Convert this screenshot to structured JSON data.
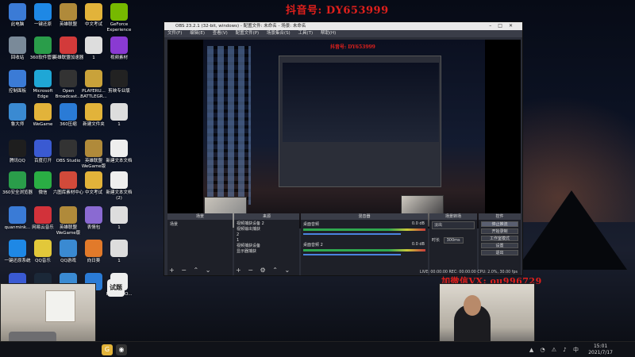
{
  "watermarks": {
    "top": "抖音号: DY653999",
    "inner": "抖音号: DY653999",
    "wechat": "加微信VX: ou996729"
  },
  "desktop_icons": [
    {
      "label": "此电脑",
      "icon": "computer-icon",
      "color": "#3b7bd6"
    },
    {
      "label": "一键还原",
      "icon": "restore-icon",
      "color": "#1e88e5"
    },
    {
      "label": "英雄联盟",
      "icon": "lol-icon",
      "color": "#b08a3a"
    },
    {
      "label": "中文考试",
      "icon": "folder-icon",
      "color": "#e2b33a"
    },
    {
      "label": "GeForce Experience",
      "icon": "nvidia-icon",
      "color": "#76b900"
    },
    {
      "label": "回收站",
      "icon": "recycle-bin-icon",
      "color": "#7a8a99"
    },
    {
      "label": "360软件管家",
      "icon": "360-manager-icon",
      "color": "#2a9d4a"
    },
    {
      "label": "英雄联盟加速器",
      "icon": "accelerator-icon",
      "color": "#d23a3a"
    },
    {
      "label": "1",
      "icon": "file-icon",
      "color": "#dddddd"
    },
    {
      "label": "视频素材",
      "icon": "video-folder-icon",
      "color": "#8a3ad2"
    },
    {
      "label": "控制面板",
      "icon": "control-panel-icon",
      "color": "#3b7bd6"
    },
    {
      "label": "Microsoft Edge",
      "icon": "edge-icon",
      "color": "#1fa7d6"
    },
    {
      "label": "Open Broadcast...",
      "icon": "obs-icon",
      "color": "#333333"
    },
    {
      "label": "PLAYERU... BATTLEGR...",
      "icon": "pubg-icon",
      "color": "#c9a23a"
    },
    {
      "label": "剪映专业版",
      "icon": "capcut-icon",
      "color": "#222222"
    },
    {
      "label": "鲁大师",
      "icon": "ludashi-icon",
      "color": "#3a8ad2"
    },
    {
      "label": "WeGame",
      "icon": "wegame-icon",
      "color": "#e2b33a"
    },
    {
      "label": "360压缩",
      "icon": "zip-icon",
      "color": "#2a7bd6"
    },
    {
      "label": "新建文件夹",
      "icon": "folder-icon",
      "color": "#e2b33a"
    },
    {
      "label": "1",
      "icon": "file-icon",
      "color": "#dddddd"
    },
    {
      "label": "腾讯QQ",
      "icon": "qq-icon",
      "color": "#1e1e1e"
    },
    {
      "label": "百度打开",
      "icon": "baidu-icon",
      "color": "#3a5ad2"
    },
    {
      "label": "OBS Studio",
      "icon": "obs-icon",
      "color": "#333333"
    },
    {
      "label": "英雄联盟 WeGame版",
      "icon": "lol-icon",
      "color": "#b08a3a"
    },
    {
      "label": "新建文本文档",
      "icon": "text-file-icon",
      "color": "#eeeeee"
    },
    {
      "label": "360安全浏览器",
      "icon": "360-browser-icon",
      "color": "#2a9d4a"
    },
    {
      "label": "微信",
      "icon": "wechat-icon",
      "color": "#2aae44"
    },
    {
      "label": "六图库素材中心",
      "icon": "gallery-icon",
      "color": "#d24a3a"
    },
    {
      "label": "中文考试",
      "icon": "folder-icon",
      "color": "#e2b33a"
    },
    {
      "label": "新建文本文档 (2)",
      "icon": "text-file-icon",
      "color": "#eeeeee"
    },
    {
      "label": "quanmink...",
      "icon": "app-icon",
      "color": "#3a7bd6"
    },
    {
      "label": "网易云音乐",
      "icon": "netease-music-icon",
      "color": "#d2323a"
    },
    {
      "label": "英雄联盟 WeGame版",
      "icon": "lol-icon",
      "color": "#b08a3a"
    },
    {
      "label": "表情包",
      "icon": "emoji-folder-icon",
      "color": "#8a6ad2"
    },
    {
      "label": "1",
      "icon": "file-icon",
      "color": "#dddddd"
    },
    {
      "label": "一键还原系统",
      "icon": "restore-icon",
      "color": "#1e88e5"
    },
    {
      "label": "QQ音乐",
      "icon": "qq-music-icon",
      "color": "#e2c83a"
    },
    {
      "label": "QQ游戏",
      "icon": "qq-game-icon",
      "color": "#3a8ad2"
    },
    {
      "label": "向日葵",
      "icon": "sunflower-icon",
      "color": "#e27a2a"
    },
    {
      "label": "1",
      "icon": "file-icon",
      "color": "#dddddd"
    },
    {
      "label": "",
      "icon": "app-icon",
      "color": "#3a5ad2"
    },
    {
      "label": "",
      "icon": "steam-icon",
      "color": "#1b2838"
    },
    {
      "label": "",
      "icon": "app-icon",
      "color": "#3a8ad2"
    },
    {
      "label": "",
      "icon": "app-icon",
      "color": "#2a7bd6"
    },
    {
      "label": "ISBTFLIEO...",
      "icon": "text-file-icon",
      "color": "#eeeeee"
    }
  ],
  "desktop_note": "试题",
  "obs": {
    "title": "OBS 23.2.1 (32-bit, windows) - 配置文件: 未命名 - 场景: 未命名",
    "menu": [
      "文件(F)",
      "编辑(E)",
      "查看(V)",
      "配置文件(P)",
      "场景集合(S)",
      "工具(T)",
      "帮助(H)"
    ],
    "docks": {
      "scenes": {
        "title": "场景",
        "items": [
          "场景"
        ]
      },
      "sources": {
        "title": "来源",
        "items": [
          "视频捕获设备 2",
          "视频输出捕获",
          "2",
          "1",
          "视频捕获设备",
          "显示器捕获"
        ]
      },
      "mixer": {
        "title": "混音器",
        "channels": [
          {
            "name": "桌面音频",
            "db": "0.0 dB"
          },
          {
            "name": "桌面音频 2",
            "db": "0.0 dB"
          }
        ]
      },
      "transitions": {
        "title": "场景转场",
        "type": "淡出",
        "duration_label": "时长",
        "duration": "300ms"
      },
      "controls": {
        "title": "控件",
        "buttons": [
          "停止推流",
          "开始录制",
          "工作室模式",
          "设置",
          "退出"
        ]
      }
    },
    "status": "LIVE: 00:00:00    REC: 00:00:00    CPU: 2.0%, 30.00 fps"
  },
  "taskbar": {
    "time": "15:01",
    "date": "2021/7/17",
    "apps": [
      "windows-icon",
      "gamepad-icon",
      "obs-icon"
    ]
  }
}
